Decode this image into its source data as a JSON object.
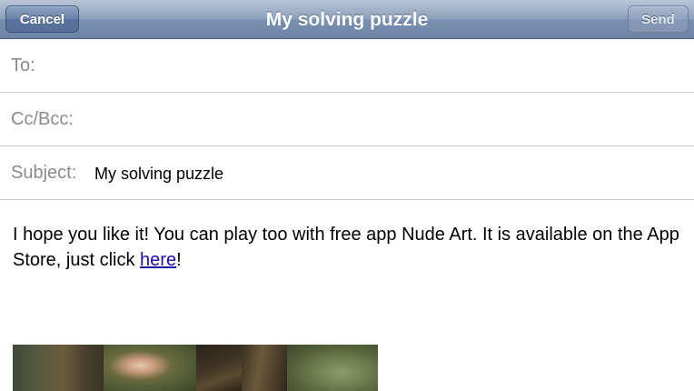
{
  "navbar": {
    "cancel_label": "Cancel",
    "title": "My solving puzzle",
    "send_label": "Send"
  },
  "fields": {
    "to_label": "To:",
    "to_value": "",
    "cc_label": "Cc/Bcc:",
    "cc_value": "",
    "subject_label": "Subject:",
    "subject_value": "My solving puzzle"
  },
  "message": {
    "text_before_link": "I hope you like it! You can play too with free app Nude Art. It is available on the App Store, just click ",
    "link_text": "here",
    "text_after_link": "!"
  },
  "attachment": {
    "tiles": [
      "tile-1",
      "tile-2",
      "tile-3",
      "tile-4",
      "tile-5"
    ]
  },
  "colors": {
    "navbar": "#7a90b0",
    "link": "#1a0dab",
    "label_gray": "#8a8a8a",
    "divider": "#c8c8c8"
  }
}
